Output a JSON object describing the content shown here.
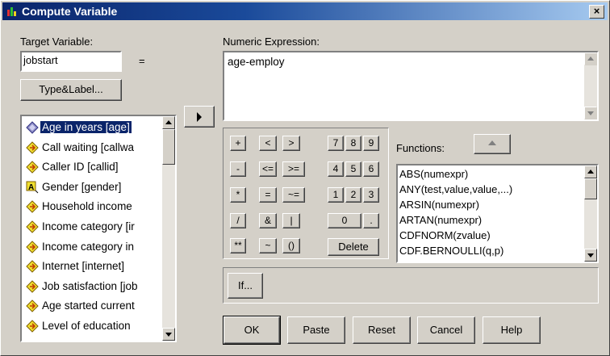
{
  "window": {
    "title": "Compute Variable",
    "close_label": "×"
  },
  "target": {
    "label": "Target Variable:",
    "value": "jobstart",
    "equals": "=",
    "type_label_button": "Type&Label..."
  },
  "expression": {
    "label": "Numeric Expression:",
    "value": "age-employ"
  },
  "variables": [
    {
      "label": "Age in years [age]",
      "icon": "scale-variable-icon",
      "selected": true
    },
    {
      "label": "Call waiting [callwa",
      "icon": "ordinal-variable-icon"
    },
    {
      "label": "Caller ID [callid]",
      "icon": "ordinal-variable-icon"
    },
    {
      "label": "Gender [gender]",
      "icon": "nominal-string-variable-icon"
    },
    {
      "label": "Household income",
      "icon": "ordinal-variable-icon"
    },
    {
      "label": "Income category [ir",
      "icon": "ordinal-variable-icon"
    },
    {
      "label": "Income category in",
      "icon": "ordinal-variable-icon"
    },
    {
      "label": "Internet [internet]",
      "icon": "ordinal-variable-icon"
    },
    {
      "label": "Job satisfaction [job",
      "icon": "ordinal-variable-icon"
    },
    {
      "label": "Age started current",
      "icon": "ordinal-variable-icon"
    },
    {
      "label": "Level of education",
      "icon": "ordinal-variable-icon"
    }
  ],
  "keypad": {
    "row1": [
      "+",
      "<",
      ">",
      "7",
      "8",
      "9"
    ],
    "row2": [
      "-",
      "<=",
      ">=",
      "4",
      "5",
      "6"
    ],
    "row3": [
      "*",
      "=",
      "~=",
      "1",
      "2",
      "3"
    ],
    "row4": [
      "/",
      "&",
      "|",
      "0",
      "."
    ],
    "row5": [
      "**",
      "~",
      "()",
      "Delete"
    ]
  },
  "functions": {
    "label": "Functions:",
    "items": [
      "ABS(numexpr)",
      "ANY(test,value,value,...)",
      "ARSIN(numexpr)",
      "ARTAN(numexpr)",
      "CDFNORM(zvalue)",
      "CDF.BERNOULLI(q,p)"
    ]
  },
  "buttons": {
    "if": "If...",
    "ok": "OK",
    "paste": "Paste",
    "reset": "Reset",
    "cancel": "Cancel",
    "help": "Help"
  }
}
